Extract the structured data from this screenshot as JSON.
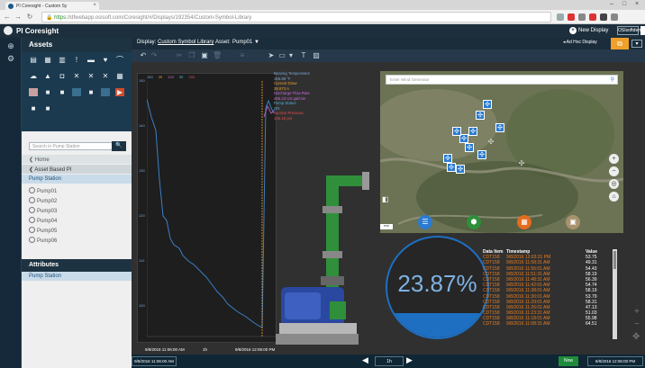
{
  "browser": {
    "tab_title": "PI Coresight - Custom Sy",
    "tab_close": "×",
    "url_secure": "https",
    "url_rest": "://dfwebapp.osisoft.com/Coresight/#/Displays/192354/Custom-Symbol-Library",
    "win_min": "–",
    "win_max": "□",
    "win_close": "×"
  },
  "app": {
    "name": "PI Coresight",
    "new_display": "New Display",
    "user": "OSIsoftdemo",
    "nav_assets": "Assets"
  },
  "display": {
    "label": "Display:",
    "name": "Custom Symbol Library",
    "asset_label": "Asset:",
    "asset_value": "Pump01",
    "adhoc": "Ad Hoc Display"
  },
  "assets_panel": {
    "title": "Assets",
    "search_placeholder": "Search in Pump Station",
    "home": "Home",
    "asset_based": "Asset Based PI",
    "pump_station": "Pump Station",
    "pumps": [
      "Pump01",
      "Pump02",
      "Pump03",
      "Pump04",
      "Pump05",
      "Pump06"
    ],
    "attributes_title": "Attributes",
    "attributes_item": "Pump Station"
  },
  "trend": {
    "scale_top": [
      "150",
      "25",
      "100",
      "35",
      "150"
    ],
    "legend": [
      {
        "text": "Bearing Temperature",
        "color": "#7aa7d6"
      },
      {
        "text": "156.88 °F",
        "color": "#7aa7d6"
      },
      {
        "text": "Current Draw",
        "color": "#f0a02a"
      },
      {
        "text": "28.873 A",
        "color": "#f0a02a"
      },
      {
        "text": "Discharge Flow Rate",
        "color": "#c56bd6"
      },
      {
        "text": "465.23 US gal/min",
        "color": "#c56bd6"
      },
      {
        "text": "Pump Status",
        "color": "#4fb0d8"
      },
      {
        "text": "ON",
        "color": "#4fb0d8"
      },
      {
        "text": "Suction Pressure",
        "color": "#e05050"
      },
      {
        "text": "146.15 psi",
        "color": "#e05050"
      }
    ],
    "axis_ticks": [
      "150",
      "140",
      "130",
      "120",
      "110",
      "100"
    ],
    "start_time": "9/8/2016 11:06:00 AM",
    "duration": "1h",
    "end_time": "9/8/2016 12:06:00 PM"
  },
  "map": {
    "search_placeholder": "Enter Wind Generator"
  },
  "gauge": {
    "value_text": "23.87%",
    "fraction": 0.2387
  },
  "table": {
    "headers": [
      "Data Item",
      "Timestamp",
      "Value"
    ],
    "rows": [
      [
        "CDT158",
        "9/8/2016 12:03:31 PM",
        "53.75"
      ],
      [
        "CDT158",
        "9/8/2016 11:58:31 AM",
        "49.31"
      ],
      [
        "CDT158",
        "9/8/2016 11:56:01 AM",
        "54.43"
      ],
      [
        "CDT158",
        "9/8/2016 11:51:31 AM",
        "58.19"
      ],
      [
        "CDT158",
        "9/8/2016 11:48:31 AM",
        "56.39"
      ],
      [
        "CDT158",
        "9/8/2016 11:42:01 AM",
        "54.74"
      ],
      [
        "CDT158",
        "9/8/2016 11:38:01 AM",
        "58.19"
      ],
      [
        "CDT158",
        "9/8/2016 11:30:01 AM",
        "53.79"
      ],
      [
        "CDT158",
        "9/8/2016 11:29:01 AM",
        "58.31"
      ],
      [
        "CDT158",
        "9/8/2016 11:26:01 AM",
        "47.13"
      ],
      [
        "CDT158",
        "9/8/2016 11:23:31 AM",
        "51.03"
      ],
      [
        "CDT158",
        "9/8/2016 11:18:01 AM",
        "55.98"
      ],
      [
        "CDT158",
        "9/8/2016 11:08:31 AM",
        "64.51"
      ]
    ]
  },
  "timebar": {
    "start": "9/8/2016 11:06:00 AM",
    "duration": "1h",
    "now": "Now",
    "end": "9/8/2016 12:06:00 PM"
  },
  "colors": {
    "accent": "#f0a02a",
    "trend_line": "#3b7fc4",
    "gauge": "#1e6fc2",
    "now_button": "#1f8b3a",
    "selected_row": "#c9dbe9"
  }
}
